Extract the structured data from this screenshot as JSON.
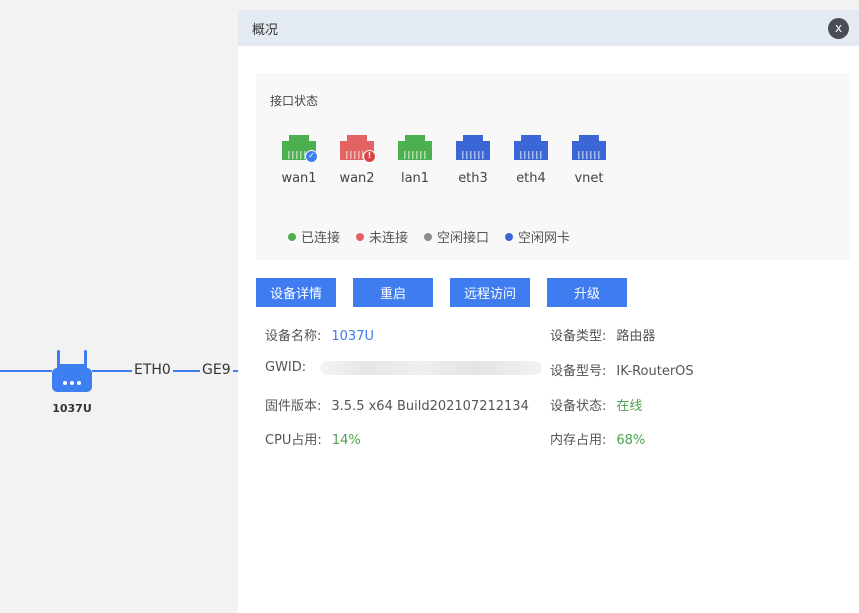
{
  "topology": {
    "router_label": "1037U",
    "ports": [
      "ETH0",
      "GE9"
    ]
  },
  "panel": {
    "title": "概况",
    "close_label": "x",
    "interface_title": "接口状态",
    "interfaces": [
      {
        "name": "wan1",
        "status": "connected",
        "color": "#4caf50",
        "badge": "✓"
      },
      {
        "name": "wan2",
        "status": "disconnected",
        "color": "#e36262",
        "badge": "!"
      },
      {
        "name": "lan1",
        "status": "connected",
        "color": "#4caf50",
        "badge": ""
      },
      {
        "name": "eth3",
        "status": "idle-nic",
        "color": "#3a66d6",
        "badge": ""
      },
      {
        "name": "eth4",
        "status": "idle-nic",
        "color": "#3a66d6",
        "badge": ""
      },
      {
        "name": "vnet",
        "status": "idle-nic",
        "color": "#3a66d6",
        "badge": ""
      }
    ],
    "legend": [
      {
        "label": "已连接",
        "color": "#4caf50"
      },
      {
        "label": "未连接",
        "color": "#e36262"
      },
      {
        "label": "空闲接口",
        "color": "#8c8c8c"
      },
      {
        "label": "空闲网卡",
        "color": "#3a66d6"
      }
    ],
    "buttons": {
      "details": "设备详情",
      "reboot": "重启",
      "remote": "远程访问",
      "upgrade": "升级"
    },
    "info": {
      "device_name_label": "设备名称:",
      "device_name": "1037U",
      "device_type_label": "设备类型:",
      "device_type": "路由器",
      "gwid_label": "GWID:",
      "model_label": "设备型号:",
      "model": "IK-RouterOS",
      "firmware_label": "固件版本:",
      "firmware": "3.5.5 x64 Build202107212134",
      "status_label": "设备状态:",
      "status": "在线",
      "cpu_label": "CPU占用:",
      "cpu": "14%",
      "mem_label": "内存占用:",
      "mem": "68%"
    }
  }
}
